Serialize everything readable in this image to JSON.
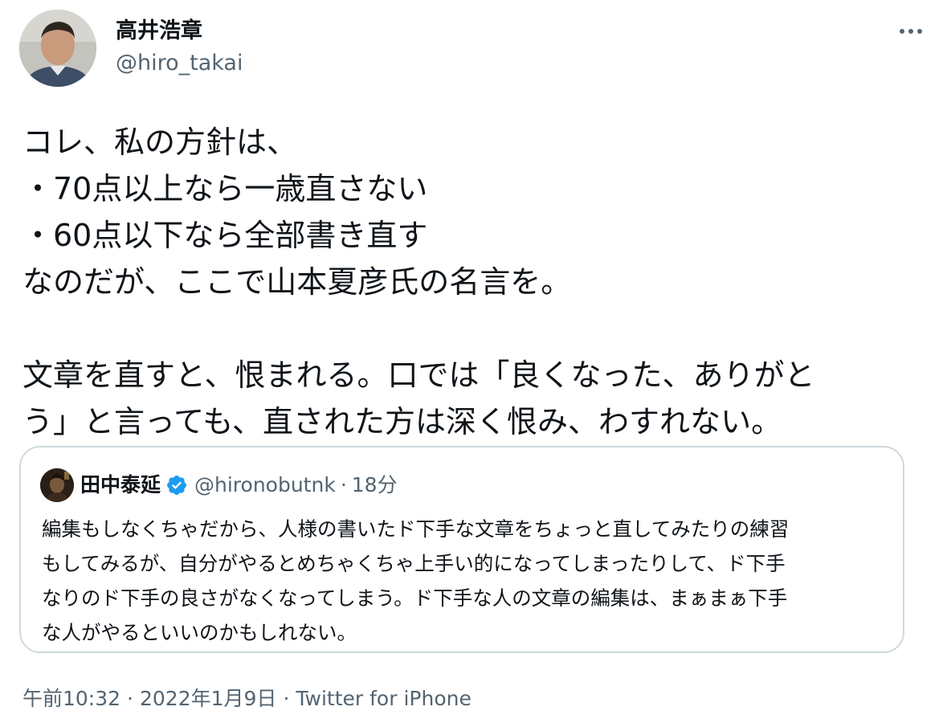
{
  "author": {
    "name": "高井浩章",
    "handle": "@hiro_takai"
  },
  "tweet": {
    "lines": [
      "コレ、私の方針は、",
      "・70点以上なら一歳直さない",
      "・60点以下なら全部書き直す",
      "なのだが、ここで山本夏彦氏の名言を。",
      "",
      "文章を直すと、恨まれる。口では「良くなった、ありがと",
      "う」と言っても、直された方は深く恨み、わすれない。"
    ]
  },
  "quote": {
    "name": "田中泰延",
    "handle": "@hironobutnk",
    "separator": "·",
    "time": "18分",
    "lines": [
      "編集もしなくちゃだから、人様の書いたド下手な文章をちょっと直してみたりの練習",
      "もしてみるが、自分がやるとめちゃくちゃ上手い的になってしまったりして、ド下手",
      "なりのド下手の良さがなくなってしまう。ド下手な人の文章の編集は、まぁまぁ下手",
      "な人がやるといいのかもしれない。"
    ]
  },
  "meta": {
    "time": "午前10:32",
    "separator1": "·",
    "date": "2022年1月9日",
    "separator2": "·",
    "source": "Twitter for iPhone"
  },
  "icons": {
    "more": "more-horizontal-icon",
    "verified": "verified-badge-icon"
  },
  "colors": {
    "text": "#0f1419",
    "secondary": "#536471",
    "verified": "#1d9bf0",
    "border": "#cfd9de"
  }
}
